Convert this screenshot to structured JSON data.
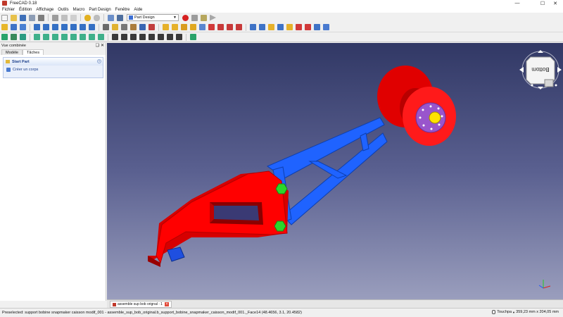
{
  "window": {
    "title": "FreeCAD 0.18"
  },
  "menubar": {
    "items": [
      "Fichier",
      "Édition",
      "Affichage",
      "Outils",
      "Macro",
      "Part Design",
      "Fenêtre",
      "Aide"
    ]
  },
  "toolbar": {
    "workbench": "Part Design"
  },
  "panel": {
    "title": "Vue combinée",
    "tabs": [
      "Modèle",
      "Tâches"
    ],
    "task_title": "Start Part",
    "task_action": "Créer un corps"
  },
  "view": {
    "navcube_label": "Bottom",
    "document_tab": "assemble sup bob orignal : 1"
  },
  "statusbar": {
    "message": "Preselected: support bobine snapmaker caisson modif_001 - assemble_sup_bob_original.b_support_bobine_snapmaker_caisson_modif_001._Face14 (48.4656, 3.1, 20.4582)",
    "nav_style": "Touchpa",
    "dimensions": "359,23 mm x 204,05 mm"
  },
  "colors": {
    "part_red": "#ff0000",
    "frame_blue": "#1f63ff",
    "nut_green": "#2bd62b",
    "bearing_purple": "#9955cc",
    "bg_top": "#313865",
    "bg_bottom": "#9a9ebd"
  }
}
